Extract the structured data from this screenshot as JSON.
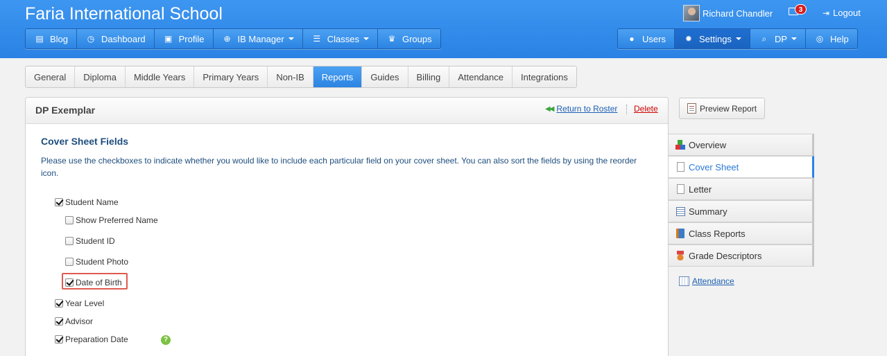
{
  "app": {
    "school_name": "Faria International School",
    "user_name": "Richard Chandler",
    "mail_count": "3",
    "logout_label": "Logout"
  },
  "nav_left": [
    {
      "label": "Blog",
      "icon": "blog-icon",
      "dropdown": false
    },
    {
      "label": "Dashboard",
      "icon": "dashboard-icon",
      "dropdown": false
    },
    {
      "label": "Profile",
      "icon": "profile-icon",
      "dropdown": false
    },
    {
      "label": "IB Manager",
      "icon": "globe-icon",
      "dropdown": true
    },
    {
      "label": "Classes",
      "icon": "classes-icon",
      "dropdown": true
    },
    {
      "label": "Groups",
      "icon": "trophy-icon",
      "dropdown": false
    }
  ],
  "nav_right": [
    {
      "label": "Users",
      "icon": "user-icon",
      "dropdown": false
    },
    {
      "label": "Settings",
      "icon": "gear-icon",
      "dropdown": true,
      "active": true
    },
    {
      "label": "DP",
      "icon": "search-icon",
      "dropdown": true
    },
    {
      "label": "Help",
      "icon": "lifebuoy-icon",
      "dropdown": false
    }
  ],
  "tabs": [
    "General",
    "Diploma",
    "Middle Years",
    "Primary Years",
    "Non-IB",
    "Reports",
    "Guides",
    "Billing",
    "Attendance",
    "Integrations"
  ],
  "active_tab": "Reports",
  "panel": {
    "title": "DP Exemplar",
    "return_label": "Return to Roster",
    "delete_label": "Delete",
    "section_title": "Cover Sheet Fields",
    "description": "Please use the checkboxes to indicate whether you would like to include each particular field on your cover sheet. You can also sort the fields by using the reorder icon."
  },
  "fields": [
    {
      "label": "Student Name",
      "checked": true
    },
    {
      "label": "Show Preferred Name",
      "checked": false
    },
    {
      "label": "Student ID",
      "checked": false
    },
    {
      "label": "Student Photo",
      "checked": false
    },
    {
      "label": "Date of Birth",
      "checked": true
    },
    {
      "label": "Year Level",
      "checked": true
    },
    {
      "label": "Advisor",
      "checked": true
    },
    {
      "label": "Preparation Date",
      "checked": true
    }
  ],
  "help_glyph": "?",
  "sidebar": {
    "preview_label": "Preview Report",
    "items": [
      {
        "label": "Overview",
        "icon": "blocks-icon"
      },
      {
        "label": "Cover Sheet",
        "icon": "page-icon",
        "active": true
      },
      {
        "label": "Letter",
        "icon": "page-icon"
      },
      {
        "label": "Summary",
        "icon": "list-icon"
      },
      {
        "label": "Class Reports",
        "icon": "book-icon"
      },
      {
        "label": "Grade Descriptors",
        "icon": "medal-icon"
      }
    ],
    "attendance_label": "Attendance"
  },
  "colors": {
    "header": "#2a82e4",
    "accent": "#2c84e2",
    "highlight_box": "#e05a4e",
    "delete": "#cc0000",
    "link": "#1a5fb4"
  }
}
